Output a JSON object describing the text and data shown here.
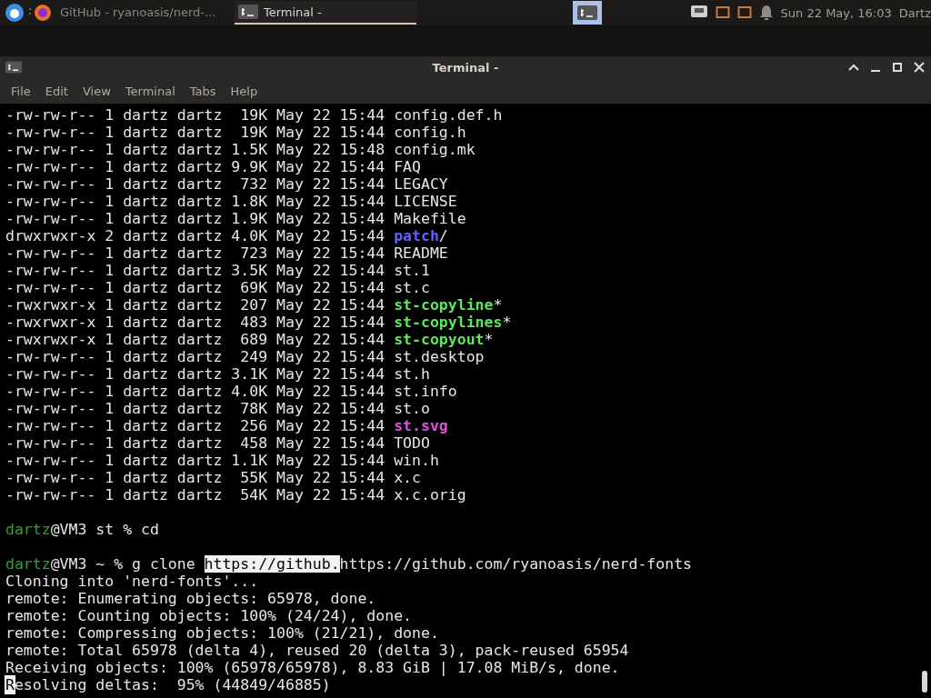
{
  "taskbar": {
    "tasks": [
      {
        "title": "GitHub - ryanoasis/nerd-...",
        "selected": false
      },
      {
        "title": "Terminal -",
        "selected": true
      }
    ],
    "clock": "Sun 22 May, 16:03",
    "user": "Dartz"
  },
  "window": {
    "title": "Terminal -"
  },
  "menu": [
    "File",
    "Edit",
    "View",
    "Terminal",
    "Tabs",
    "Help"
  ],
  "terminal": {
    "lines": [
      {
        "kind": "text",
        "segments": [
          {
            "text": "-rw-rw-r-- 1 dartz dartz  19K May 22 15:44 ",
            "kind": "plain"
          },
          {
            "text": "config.def.h",
            "kind": "plain"
          }
        ]
      },
      {
        "kind": "text",
        "segments": [
          {
            "text": "-rw-rw-r-- 1 dartz dartz  19K May 22 15:44 ",
            "kind": "plain"
          },
          {
            "text": "config.h",
            "kind": "plain"
          }
        ]
      },
      {
        "kind": "text",
        "segments": [
          {
            "text": "-rw-rw-r-- 1 dartz dartz 1.5K May 22 15:48 ",
            "kind": "plain"
          },
          {
            "text": "config.mk",
            "kind": "plain"
          }
        ]
      },
      {
        "kind": "text",
        "segments": [
          {
            "text": "-rw-rw-r-- 1 dartz dartz 9.9K May 22 15:44 ",
            "kind": "plain"
          },
          {
            "text": "FAQ",
            "kind": "plain"
          }
        ]
      },
      {
        "kind": "text",
        "segments": [
          {
            "text": "-rw-rw-r-- 1 dartz dartz  732 May 22 15:44 ",
            "kind": "plain"
          },
          {
            "text": "LEGACY",
            "kind": "plain"
          }
        ]
      },
      {
        "kind": "text",
        "segments": [
          {
            "text": "-rw-rw-r-- 1 dartz dartz 1.8K May 22 15:44 ",
            "kind": "plain"
          },
          {
            "text": "LICENSE",
            "kind": "plain"
          }
        ]
      },
      {
        "kind": "text",
        "segments": [
          {
            "text": "-rw-rw-r-- 1 dartz dartz 1.9K May 22 15:44 ",
            "kind": "plain"
          },
          {
            "text": "Makefile",
            "kind": "plain"
          }
        ]
      },
      {
        "kind": "text",
        "segments": [
          {
            "text": "drwxrwxr-x 2 dartz dartz 4.0K May 22 15:44 ",
            "kind": "plain"
          },
          {
            "text": "patch",
            "kind": "dir"
          },
          {
            "text": "/",
            "kind": "plain"
          }
        ]
      },
      {
        "kind": "text",
        "segments": [
          {
            "text": "-rw-rw-r-- 1 dartz dartz  723 May 22 15:44 ",
            "kind": "plain"
          },
          {
            "text": "README",
            "kind": "plain"
          }
        ]
      },
      {
        "kind": "text",
        "segments": [
          {
            "text": "-rw-rw-r-- 1 dartz dartz 3.5K May 22 15:44 ",
            "kind": "plain"
          },
          {
            "text": "st.1",
            "kind": "plain"
          }
        ]
      },
      {
        "kind": "text",
        "segments": [
          {
            "text": "-rw-rw-r-- 1 dartz dartz  69K May 22 15:44 ",
            "kind": "plain"
          },
          {
            "text": "st.c",
            "kind": "plain"
          }
        ]
      },
      {
        "kind": "text",
        "segments": [
          {
            "text": "-rwxrwxr-x 1 dartz dartz  207 May 22 15:44 ",
            "kind": "plain"
          },
          {
            "text": "st-copyline",
            "kind": "exec"
          },
          {
            "text": "*",
            "kind": "plain"
          }
        ]
      },
      {
        "kind": "text",
        "segments": [
          {
            "text": "-rwxrwxr-x 1 dartz dartz  483 May 22 15:44 ",
            "kind": "plain"
          },
          {
            "text": "st-copylines",
            "kind": "exec"
          },
          {
            "text": "*",
            "kind": "plain"
          }
        ]
      },
      {
        "kind": "text",
        "segments": [
          {
            "text": "-rwxrwxr-x 1 dartz dartz  689 May 22 15:44 ",
            "kind": "plain"
          },
          {
            "text": "st-copyout",
            "kind": "exec"
          },
          {
            "text": "*",
            "kind": "plain"
          }
        ]
      },
      {
        "kind": "text",
        "segments": [
          {
            "text": "-rw-rw-r-- 1 dartz dartz  249 May 22 15:44 ",
            "kind": "plain"
          },
          {
            "text": "st.desktop",
            "kind": "plain"
          }
        ]
      },
      {
        "kind": "text",
        "segments": [
          {
            "text": "-rw-rw-r-- 1 dartz dartz 3.1K May 22 15:44 ",
            "kind": "plain"
          },
          {
            "text": "st.h",
            "kind": "plain"
          }
        ]
      },
      {
        "kind": "text",
        "segments": [
          {
            "text": "-rw-rw-r-- 1 dartz dartz 4.0K May 22 15:44 ",
            "kind": "plain"
          },
          {
            "text": "st.info",
            "kind": "plain"
          }
        ]
      },
      {
        "kind": "text",
        "segments": [
          {
            "text": "-rw-rw-r-- 1 dartz dartz  78K May 22 15:44 ",
            "kind": "plain"
          },
          {
            "text": "st.o",
            "kind": "plain"
          }
        ]
      },
      {
        "kind": "text",
        "segments": [
          {
            "text": "-rw-rw-r-- 1 dartz dartz  256 May 22 15:44 ",
            "kind": "plain"
          },
          {
            "text": "st.svg",
            "kind": "image"
          }
        ]
      },
      {
        "kind": "text",
        "segments": [
          {
            "text": "-rw-rw-r-- 1 dartz dartz  458 May 22 15:44 ",
            "kind": "plain"
          },
          {
            "text": "TODO",
            "kind": "plain"
          }
        ]
      },
      {
        "kind": "text",
        "segments": [
          {
            "text": "-rw-rw-r-- 1 dartz dartz 1.1K May 22 15:44 ",
            "kind": "plain"
          },
          {
            "text": "win.h",
            "kind": "plain"
          }
        ]
      },
      {
        "kind": "text",
        "segments": [
          {
            "text": "-rw-rw-r-- 1 dartz dartz  55K May 22 15:44 ",
            "kind": "plain"
          },
          {
            "text": "x.c",
            "kind": "plain"
          }
        ]
      },
      {
        "kind": "text",
        "segments": [
          {
            "text": "-rw-rw-r-- 1 dartz dartz  54K May 22 15:44 ",
            "kind": "plain"
          },
          {
            "text": "x.c.orig",
            "kind": "plain"
          }
        ]
      },
      {
        "kind": "blank"
      },
      {
        "kind": "text",
        "segments": [
          {
            "text": "dartz",
            "kind": "user"
          },
          {
            "text": "@VM3 st % cd",
            "kind": "plain"
          }
        ]
      },
      {
        "kind": "blank"
      },
      {
        "kind": "text",
        "segments": [
          {
            "text": "dartz",
            "kind": "user"
          },
          {
            "text": "@VM3 ~ % g clone ",
            "kind": "plain"
          },
          {
            "text": "https://github.",
            "kind": "selection"
          },
          {
            "text": "https://github.com/ryanoasis/nerd-fonts",
            "kind": "plain"
          }
        ]
      },
      {
        "kind": "text",
        "segments": [
          {
            "text": "Cloning into 'nerd-fonts'...",
            "kind": "plain"
          }
        ]
      },
      {
        "kind": "text",
        "segments": [
          {
            "text": "remote: Enumerating objects: 65978, done.",
            "kind": "plain"
          }
        ]
      },
      {
        "kind": "text",
        "segments": [
          {
            "text": "remote: Counting objects: 100% (24/24), done.",
            "kind": "plain"
          }
        ]
      },
      {
        "kind": "text",
        "segments": [
          {
            "text": "remote: Compressing objects: 100% (21/21), done.",
            "kind": "plain"
          }
        ]
      },
      {
        "kind": "text",
        "segments": [
          {
            "text": "remote: Total 65978 (delta 4), reused 20 (delta 3), pack-reused 65954",
            "kind": "plain"
          }
        ]
      },
      {
        "kind": "text",
        "segments": [
          {
            "text": "Receiving objects: 100% (65978/65978), 8.83 GiB | 17.08 MiB/s, done.",
            "kind": "plain"
          }
        ]
      },
      {
        "kind": "text",
        "segments": [
          {
            "text": "R",
            "kind": "cursor"
          },
          {
            "text": "esolving deltas:  95% (44849/46885)",
            "kind": "plain"
          }
        ]
      }
    ]
  }
}
